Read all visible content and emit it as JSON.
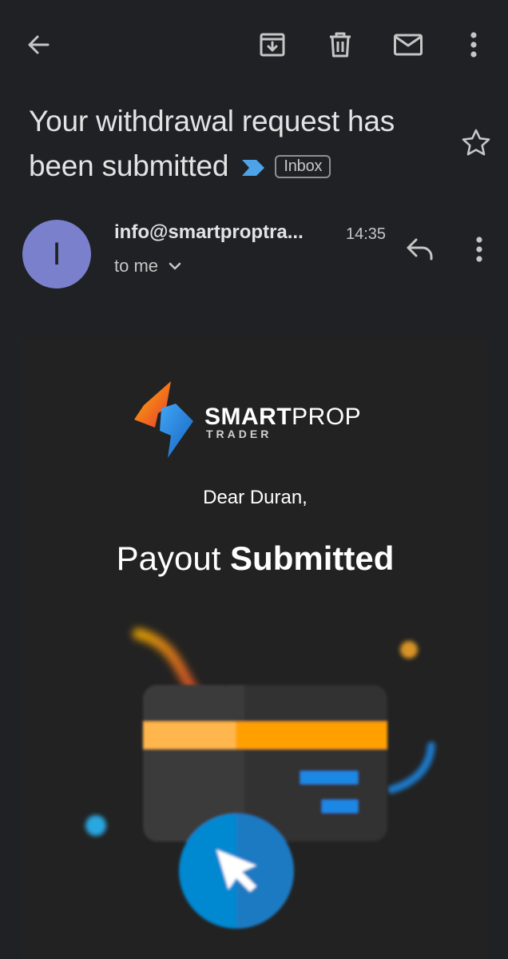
{
  "toolbar": {
    "back_icon": "arrow-back-icon",
    "archive_icon": "archive-icon",
    "delete_icon": "trash-icon",
    "mark_unread_icon": "mail-icon",
    "more_icon": "more-vert-icon"
  },
  "email": {
    "subject": "Your withdrawal request has been submitted",
    "label": "Inbox",
    "starred": false,
    "sender": {
      "initial": "I",
      "name": "info@smartproptra...",
      "time": "14:35",
      "recipient": "to me"
    }
  },
  "body": {
    "logo": {
      "brand_bold": "SMART",
      "brand_light": "PROP",
      "brand_sub": "TRADER"
    },
    "greeting": "Dear Duran,",
    "headline_regular": "Payout",
    "headline_bold": "Submitted"
  },
  "colors": {
    "background": "#1f2125",
    "avatar": "#7a80cc",
    "importance_marker": "#4ea3e8",
    "card_stripe": "#ffa000",
    "cursor_circle": "#0288d1"
  }
}
